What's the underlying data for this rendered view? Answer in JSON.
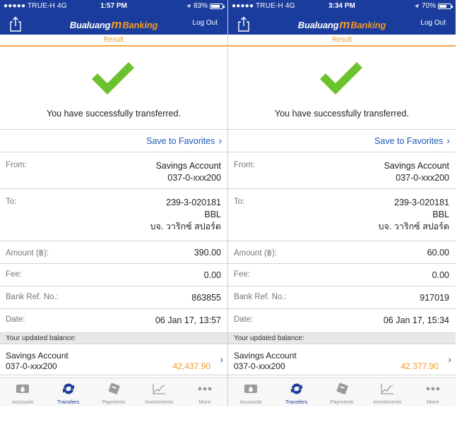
{
  "colors": {
    "brand_blue": "#1a3c9c",
    "accent_orange": "#f39a1e",
    "success_green": "#6cc22e",
    "link_blue": "#1f56b3"
  },
  "screens": [
    {
      "status": {
        "carrier": "●●●●● TRUE-H   4G",
        "time": "1:57 PM",
        "battery": "83%",
        "battery_level": 0.83
      },
      "nav": {
        "logo_main": "Bualuang",
        "logo_m": "m",
        "logo_banking": "Banking",
        "logout": "Log Out"
      },
      "step": "Result",
      "success_message": "You have successfully transferred.",
      "save_favorites": "Save to Favorites",
      "from": {
        "label": "From:",
        "account_type": "Savings Account",
        "account_no": "037-0-xxx200"
      },
      "to": {
        "label": "To:",
        "account_no": "239-3-020181",
        "bank": "BBL",
        "name": "บจ. วาริกซ์ สปอร์ต"
      },
      "amount": {
        "label": "Amount (฿):",
        "value": "390.00"
      },
      "fee": {
        "label": "Fee:",
        "value": "0.00"
      },
      "ref": {
        "label": "Bank Ref. No.:",
        "value": "863855"
      },
      "date": {
        "label": "Date:",
        "value": "06 Jan 17, 13:57"
      },
      "balance": {
        "header": "Your updated balance:",
        "account_type": "Savings Account",
        "account_no": "037-0-xxx200",
        "amount": "42,437.90"
      },
      "tabs": [
        {
          "label": "Accounts",
          "icon": "accounts-icon"
        },
        {
          "label": "Transfers",
          "icon": "transfers-icon"
        },
        {
          "label": "Payments",
          "icon": "payments-icon"
        },
        {
          "label": "Investments",
          "icon": "investments-icon"
        },
        {
          "label": "More",
          "icon": "more-icon"
        }
      ]
    },
    {
      "status": {
        "carrier": "●●●●● TRUE-H   4G",
        "time": "3:34 PM",
        "battery": "70%",
        "battery_level": 0.7
      },
      "nav": {
        "logo_main": "Bualuang",
        "logo_m": "m",
        "logo_banking": "Banking",
        "logout": "Log Out"
      },
      "step": "Result",
      "success_message": "You have successfully transferred.",
      "save_favorites": "Save to Favorites",
      "from": {
        "label": "From:",
        "account_type": "Savings Account",
        "account_no": "037-0-xxx200"
      },
      "to": {
        "label": "To:",
        "account_no": "239-3-020181",
        "bank": "BBL",
        "name": "บจ. วาริกซ์ สปอร์ต"
      },
      "amount": {
        "label": "Amount (฿):",
        "value": "60.00"
      },
      "fee": {
        "label": "Fee:",
        "value": "0.00"
      },
      "ref": {
        "label": "Bank Ref. No.:",
        "value": "917019"
      },
      "date": {
        "label": "Date:",
        "value": "06 Jan 17, 15:34"
      },
      "balance": {
        "header": "Your updated balance:",
        "account_type": "Savings Account",
        "account_no": "037-0-xxx200",
        "amount": "42,377.90"
      },
      "tabs": [
        {
          "label": "Accounts",
          "icon": "accounts-icon"
        },
        {
          "label": "Transfers",
          "icon": "transfers-icon"
        },
        {
          "label": "Payments",
          "icon": "payments-icon"
        },
        {
          "label": "Investments",
          "icon": "investments-icon"
        },
        {
          "label": "More",
          "icon": "more-icon"
        }
      ]
    }
  ]
}
